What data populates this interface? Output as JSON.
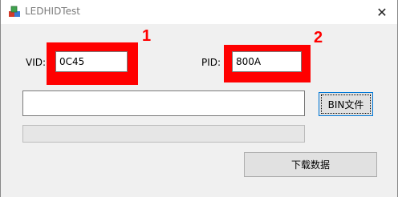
{
  "window": {
    "title": "LEDHIDTest",
    "close_symbol": "✕"
  },
  "vid": {
    "label": "VID:",
    "value": "0C45",
    "annotation": "1"
  },
  "pid": {
    "label": "PID:",
    "value": "800A",
    "annotation": "2"
  },
  "file": {
    "path_value": "",
    "browse_label": "BIN文件"
  },
  "progress": {
    "value": 0
  },
  "actions": {
    "download_label": "下载数据"
  },
  "colors": {
    "annotation": "#ff0000",
    "focus_border": "#0078d7"
  }
}
